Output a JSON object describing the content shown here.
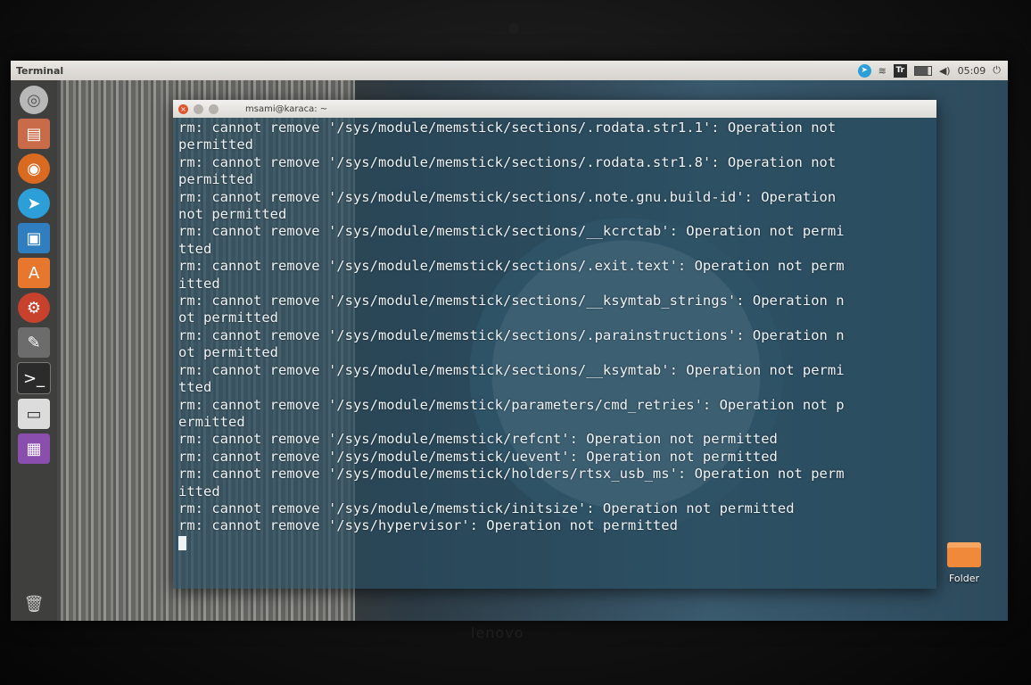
{
  "panel": {
    "app_title": "Terminal",
    "clock": "05:09",
    "indicators": [
      {
        "icon": "telegram-icon",
        "glyph": "➤"
      },
      {
        "icon": "wifi-icon",
        "glyph": "≋"
      },
      {
        "icon": "translate-icon",
        "glyph": "Tr"
      },
      {
        "icon": "battery-icon",
        "glyph": ""
      },
      {
        "icon": "volume-icon",
        "glyph": "◀)"
      }
    ],
    "power_glyph": "⏻"
  },
  "launcher": {
    "items": [
      {
        "name": "dash",
        "glyph": "◎"
      },
      {
        "name": "files",
        "glyph": "▤"
      },
      {
        "name": "firefox",
        "glyph": "◉"
      },
      {
        "name": "telegram",
        "glyph": "➤"
      },
      {
        "name": "vbox",
        "glyph": "▣"
      },
      {
        "name": "software",
        "glyph": "A"
      },
      {
        "name": "settings",
        "glyph": "⚙"
      },
      {
        "name": "tool",
        "glyph": "✎"
      },
      {
        "name": "terminal",
        "glyph": ">_"
      },
      {
        "name": "disk",
        "glyph": "▭"
      },
      {
        "name": "purple",
        "glyph": "▦"
      }
    ],
    "trash_glyph": "🗑"
  },
  "terminal": {
    "title": "msami@karaca: ~",
    "lines": [
      "rm: cannot remove '/sys/module/memstick/sections/.rodata.str1.1': Operation not",
      "permitted",
      "rm: cannot remove '/sys/module/memstick/sections/.rodata.str1.8': Operation not",
      "permitted",
      "rm: cannot remove '/sys/module/memstick/sections/.note.gnu.build-id': Operation",
      "not permitted",
      "rm: cannot remove '/sys/module/memstick/sections/__kcrctab': Operation not permi",
      "tted",
      "rm: cannot remove '/sys/module/memstick/sections/.exit.text': Operation not perm",
      "itted",
      "rm: cannot remove '/sys/module/memstick/sections/__ksymtab_strings': Operation n",
      "ot permitted",
      "rm: cannot remove '/sys/module/memstick/sections/.parainstructions': Operation n",
      "ot permitted",
      "rm: cannot remove '/sys/module/memstick/sections/__ksymtab': Operation not permi",
      "tted",
      "rm: cannot remove '/sys/module/memstick/parameters/cmd_retries': Operation not p",
      "ermitted",
      "rm: cannot remove '/sys/module/memstick/refcnt': Operation not permitted",
      "rm: cannot remove '/sys/module/memstick/uevent': Operation not permitted",
      "rm: cannot remove '/sys/module/memstick/holders/rtsx_usb_ms': Operation not perm",
      "itted",
      "rm: cannot remove '/sys/module/memstick/initsize': Operation not permitted",
      "rm: cannot remove '/sys/hypervisor': Operation not permitted"
    ]
  },
  "desktop": {
    "folder_label": "Folder"
  },
  "laptop": {
    "brand": "lenovo"
  }
}
